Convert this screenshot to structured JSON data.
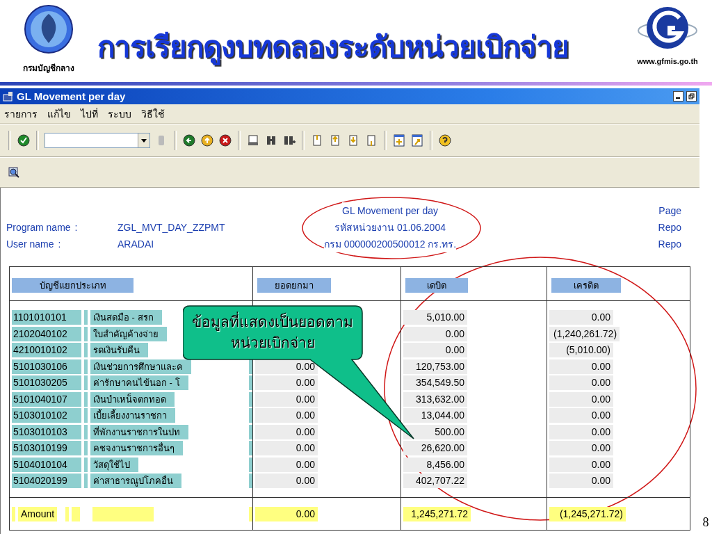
{
  "slide": {
    "title": "การเรียกดูงบทดลองระดับหน่วยเบิกจ่าย",
    "org_label": "กรมบัญชีกลาง",
    "website": "www.gfmis.go.th",
    "page_number": "8"
  },
  "window": {
    "title": "GL Movement per day"
  },
  "menu": [
    "รายการ",
    "แก้ไข",
    "ไปที่",
    "ระบบ",
    "วิธีใช้"
  ],
  "report": {
    "fields": [
      {
        "label": "Program name",
        "separator": ":",
        "value": "ZGL_MVT_DAY_ZZPMT"
      },
      {
        "label": "User name",
        "separator": ":",
        "value": "ARADAI"
      }
    ],
    "center_lines": [
      "GL Movement per day",
      "รหัสหน่วยงาน 01.06.2004",
      "กรม 000000200500012 กร.ทร."
    ],
    "right_lines": [
      "Page",
      "Repo",
      "Repo"
    ]
  },
  "table": {
    "columns": [
      "บัญชีแยกประเภท",
      "ยอดยกมา",
      "เดบิต",
      "เครดิต"
    ],
    "rows": [
      {
        "account": "1101010101",
        "name": "เงินสดมือ - สรก",
        "debit": "5,010.00",
        "credit": "0.00"
      },
      {
        "account": "2102040102",
        "name": "ใบสำคัญค้างจ่าย",
        "debit": "0.00",
        "credit": "(1,240,261.72)"
      },
      {
        "account": "4210010102",
        "name": "รดเงินรับคืน",
        "debit": "0.00",
        "credit": "(5,010.00)"
      },
      {
        "account": "5101030106",
        "name": "เงินช่วยการศึกษาและค",
        "brought_forward": "0.00",
        "debit": "120,753.00",
        "credit": "0.00"
      },
      {
        "account": "5101030205",
        "name": "ค่ารักษาคนไข้นอก - โ",
        "brought_forward": "0.00",
        "debit": "354,549.50",
        "credit": "0.00"
      },
      {
        "account": "5101040107",
        "name": "เงินบำเหน็จตกทอด",
        "brought_forward": "0.00",
        "debit": "313,632.00",
        "credit": "0.00"
      },
      {
        "account": "5103010102",
        "name": "เบี้ยเลี้ยงงานราชกา",
        "brought_forward": "0.00",
        "debit": "13,044.00",
        "credit": "0.00"
      },
      {
        "account": "5103010103",
        "name": "ที่พักงานราชการในปท",
        "brought_forward": "0.00",
        "debit": "500.00",
        "credit": "0.00"
      },
      {
        "account": "5103010199",
        "name": "คชจงานราชการอื่นๆ",
        "brought_forward": "0.00",
        "debit": "26,620.00",
        "credit": "0.00"
      },
      {
        "account": "5104010104",
        "name": "วัสดุใช้ไป",
        "brought_forward": "0.00",
        "debit": "8,456.00",
        "credit": "0.00"
      },
      {
        "account": "5104020199",
        "name": "ค่าสาธารณูปโภคอื่น",
        "brought_forward": "0.00",
        "debit": "402,707.22",
        "credit": "0.00"
      }
    ],
    "total": {
      "label": "Amount",
      "brought_forward": "0.00",
      "debit": "1,245,271.72",
      "credit": "(1,245,271.72)"
    }
  },
  "callout": {
    "lines": [
      "ข้อมูลที่แสดงเป็นยอดตาม",
      "หน่วยเบิกจ่าย"
    ]
  }
}
